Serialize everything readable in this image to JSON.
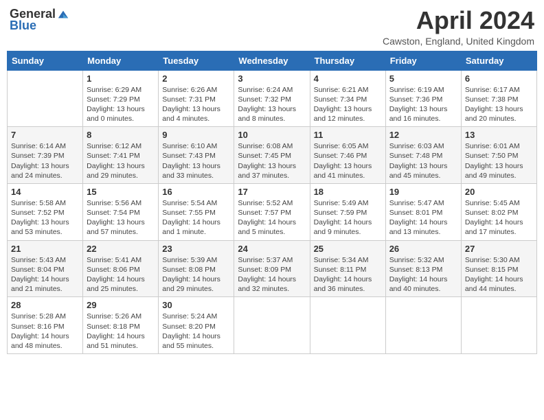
{
  "logo": {
    "general": "General",
    "blue": "Blue"
  },
  "title": "April 2024",
  "subtitle": "Cawston, England, United Kingdom",
  "days": [
    "Sunday",
    "Monday",
    "Tuesday",
    "Wednesday",
    "Thursday",
    "Friday",
    "Saturday"
  ],
  "weeks": [
    [
      {
        "num": "",
        "lines": []
      },
      {
        "num": "1",
        "lines": [
          "Sunrise: 6:29 AM",
          "Sunset: 7:29 PM",
          "Daylight: 13 hours",
          "and 0 minutes."
        ]
      },
      {
        "num": "2",
        "lines": [
          "Sunrise: 6:26 AM",
          "Sunset: 7:31 PM",
          "Daylight: 13 hours",
          "and 4 minutes."
        ]
      },
      {
        "num": "3",
        "lines": [
          "Sunrise: 6:24 AM",
          "Sunset: 7:32 PM",
          "Daylight: 13 hours",
          "and 8 minutes."
        ]
      },
      {
        "num": "4",
        "lines": [
          "Sunrise: 6:21 AM",
          "Sunset: 7:34 PM",
          "Daylight: 13 hours",
          "and 12 minutes."
        ]
      },
      {
        "num": "5",
        "lines": [
          "Sunrise: 6:19 AM",
          "Sunset: 7:36 PM",
          "Daylight: 13 hours",
          "and 16 minutes."
        ]
      },
      {
        "num": "6",
        "lines": [
          "Sunrise: 6:17 AM",
          "Sunset: 7:38 PM",
          "Daylight: 13 hours",
          "and 20 minutes."
        ]
      }
    ],
    [
      {
        "num": "7",
        "lines": [
          "Sunrise: 6:14 AM",
          "Sunset: 7:39 PM",
          "Daylight: 13 hours",
          "and 24 minutes."
        ]
      },
      {
        "num": "8",
        "lines": [
          "Sunrise: 6:12 AM",
          "Sunset: 7:41 PM",
          "Daylight: 13 hours",
          "and 29 minutes."
        ]
      },
      {
        "num": "9",
        "lines": [
          "Sunrise: 6:10 AM",
          "Sunset: 7:43 PM",
          "Daylight: 13 hours",
          "and 33 minutes."
        ]
      },
      {
        "num": "10",
        "lines": [
          "Sunrise: 6:08 AM",
          "Sunset: 7:45 PM",
          "Daylight: 13 hours",
          "and 37 minutes."
        ]
      },
      {
        "num": "11",
        "lines": [
          "Sunrise: 6:05 AM",
          "Sunset: 7:46 PM",
          "Daylight: 13 hours",
          "and 41 minutes."
        ]
      },
      {
        "num": "12",
        "lines": [
          "Sunrise: 6:03 AM",
          "Sunset: 7:48 PM",
          "Daylight: 13 hours",
          "and 45 minutes."
        ]
      },
      {
        "num": "13",
        "lines": [
          "Sunrise: 6:01 AM",
          "Sunset: 7:50 PM",
          "Daylight: 13 hours",
          "and 49 minutes."
        ]
      }
    ],
    [
      {
        "num": "14",
        "lines": [
          "Sunrise: 5:58 AM",
          "Sunset: 7:52 PM",
          "Daylight: 13 hours",
          "and 53 minutes."
        ]
      },
      {
        "num": "15",
        "lines": [
          "Sunrise: 5:56 AM",
          "Sunset: 7:54 PM",
          "Daylight: 13 hours",
          "and 57 minutes."
        ]
      },
      {
        "num": "16",
        "lines": [
          "Sunrise: 5:54 AM",
          "Sunset: 7:55 PM",
          "Daylight: 14 hours",
          "and 1 minute."
        ]
      },
      {
        "num": "17",
        "lines": [
          "Sunrise: 5:52 AM",
          "Sunset: 7:57 PM",
          "Daylight: 14 hours",
          "and 5 minutes."
        ]
      },
      {
        "num": "18",
        "lines": [
          "Sunrise: 5:49 AM",
          "Sunset: 7:59 PM",
          "Daylight: 14 hours",
          "and 9 minutes."
        ]
      },
      {
        "num": "19",
        "lines": [
          "Sunrise: 5:47 AM",
          "Sunset: 8:01 PM",
          "Daylight: 14 hours",
          "and 13 minutes."
        ]
      },
      {
        "num": "20",
        "lines": [
          "Sunrise: 5:45 AM",
          "Sunset: 8:02 PM",
          "Daylight: 14 hours",
          "and 17 minutes."
        ]
      }
    ],
    [
      {
        "num": "21",
        "lines": [
          "Sunrise: 5:43 AM",
          "Sunset: 8:04 PM",
          "Daylight: 14 hours",
          "and 21 minutes."
        ]
      },
      {
        "num": "22",
        "lines": [
          "Sunrise: 5:41 AM",
          "Sunset: 8:06 PM",
          "Daylight: 14 hours",
          "and 25 minutes."
        ]
      },
      {
        "num": "23",
        "lines": [
          "Sunrise: 5:39 AM",
          "Sunset: 8:08 PM",
          "Daylight: 14 hours",
          "and 29 minutes."
        ]
      },
      {
        "num": "24",
        "lines": [
          "Sunrise: 5:37 AM",
          "Sunset: 8:09 PM",
          "Daylight: 14 hours",
          "and 32 minutes."
        ]
      },
      {
        "num": "25",
        "lines": [
          "Sunrise: 5:34 AM",
          "Sunset: 8:11 PM",
          "Daylight: 14 hours",
          "and 36 minutes."
        ]
      },
      {
        "num": "26",
        "lines": [
          "Sunrise: 5:32 AM",
          "Sunset: 8:13 PM",
          "Daylight: 14 hours",
          "and 40 minutes."
        ]
      },
      {
        "num": "27",
        "lines": [
          "Sunrise: 5:30 AM",
          "Sunset: 8:15 PM",
          "Daylight: 14 hours",
          "and 44 minutes."
        ]
      }
    ],
    [
      {
        "num": "28",
        "lines": [
          "Sunrise: 5:28 AM",
          "Sunset: 8:16 PM",
          "Daylight: 14 hours",
          "and 48 minutes."
        ]
      },
      {
        "num": "29",
        "lines": [
          "Sunrise: 5:26 AM",
          "Sunset: 8:18 PM",
          "Daylight: 14 hours",
          "and 51 minutes."
        ]
      },
      {
        "num": "30",
        "lines": [
          "Sunrise: 5:24 AM",
          "Sunset: 8:20 PM",
          "Daylight: 14 hours",
          "and 55 minutes."
        ]
      },
      {
        "num": "",
        "lines": []
      },
      {
        "num": "",
        "lines": []
      },
      {
        "num": "",
        "lines": []
      },
      {
        "num": "",
        "lines": []
      }
    ]
  ]
}
